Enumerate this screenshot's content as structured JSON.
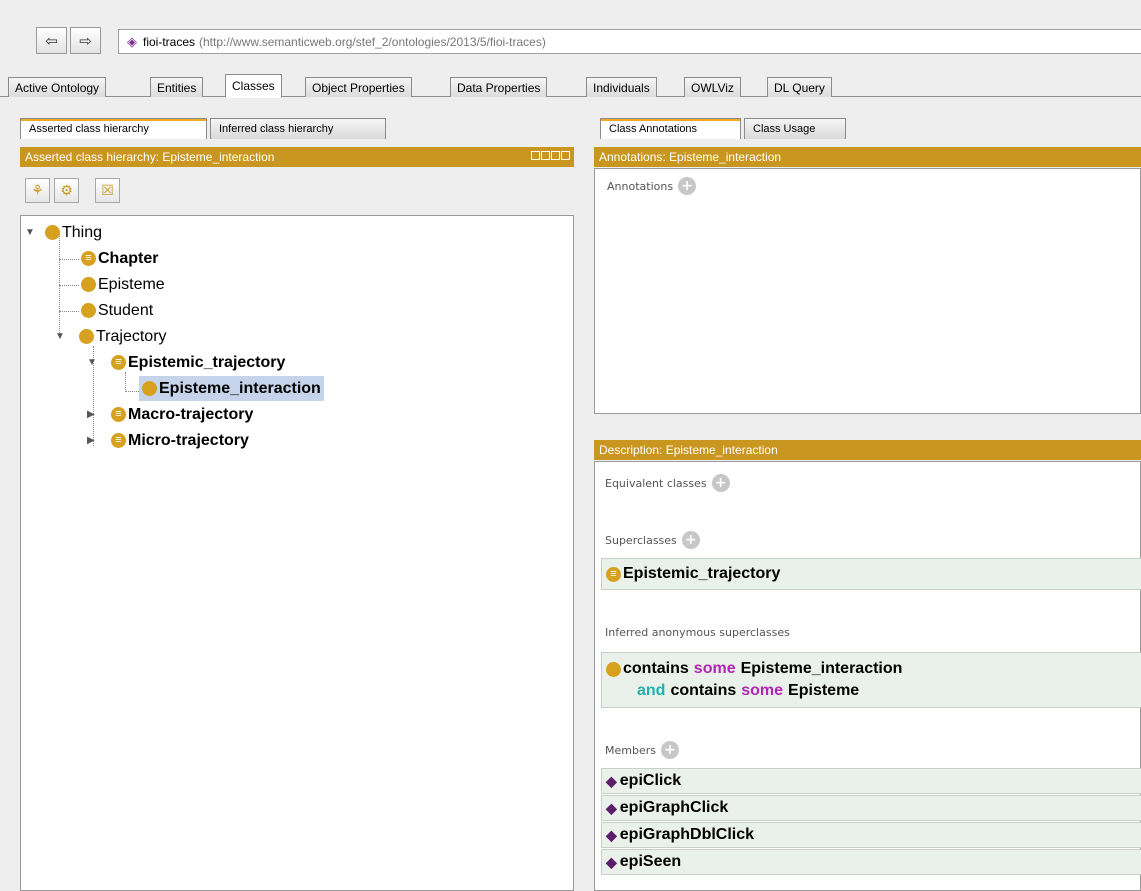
{
  "toolbar": {
    "back_icon": "back-arrow-icon",
    "forward_icon": "forward-arrow-icon",
    "ontology_name": "fioi-traces",
    "ontology_iri": "(http://www.semanticweb.org/stef_2/ontologies/2013/5/fioi-traces)"
  },
  "main_tabs": [
    "Active Ontology",
    "Entities",
    "Classes",
    "Object Properties",
    "Data Properties",
    "Individuals",
    "OWLViz",
    "DL Query"
  ],
  "main_tab_active": "Classes",
  "left": {
    "tabs": [
      "Asserted class hierarchy",
      "Inferred class hierarchy"
    ],
    "header": "Asserted class hierarchy: Episteme_interaction",
    "tree": {
      "thing": "Thing",
      "chapter": "Chapter",
      "episteme": "Episteme",
      "student": "Student",
      "trajectory": "Trajectory",
      "epistemic_trajectory": "Epistemic_trajectory",
      "episteme_interaction": "Episteme_interaction",
      "macro_trajectory": "Macro-trajectory",
      "micro_trajectory": "Micro-trajectory"
    }
  },
  "right": {
    "tabs": [
      "Class Annotations",
      "Class Usage"
    ],
    "annotations_header": "Annotations: Episteme_interaction",
    "annotations_label": "Annotations",
    "description_header": "Description: Episteme_interaction",
    "equivalent_label": "Equivalent classes",
    "superclasses_label": "Superclasses",
    "superclass": "Epistemic_trajectory",
    "inferred_label": "Inferred anonymous superclasses",
    "inferred": {
      "line1_a": "contains",
      "line1_some": "some",
      "line1_b": "Episteme_interaction",
      "line2_and": "and",
      "line2_a": "contains",
      "line2_some": "some",
      "line2_b": "Episteme"
    },
    "members_label": "Members",
    "members": [
      "epiClick",
      "epiGraphClick",
      "epiGraphDblClick",
      "epiSeen"
    ]
  },
  "colors": {
    "header_gold": "#c9961f",
    "class_dot": "#d6a11f",
    "individual_diamond": "#5a1d6a",
    "keyword_some": "#b127b5",
    "keyword_and": "#1fb2b0",
    "selection": "#c5d4ea"
  }
}
